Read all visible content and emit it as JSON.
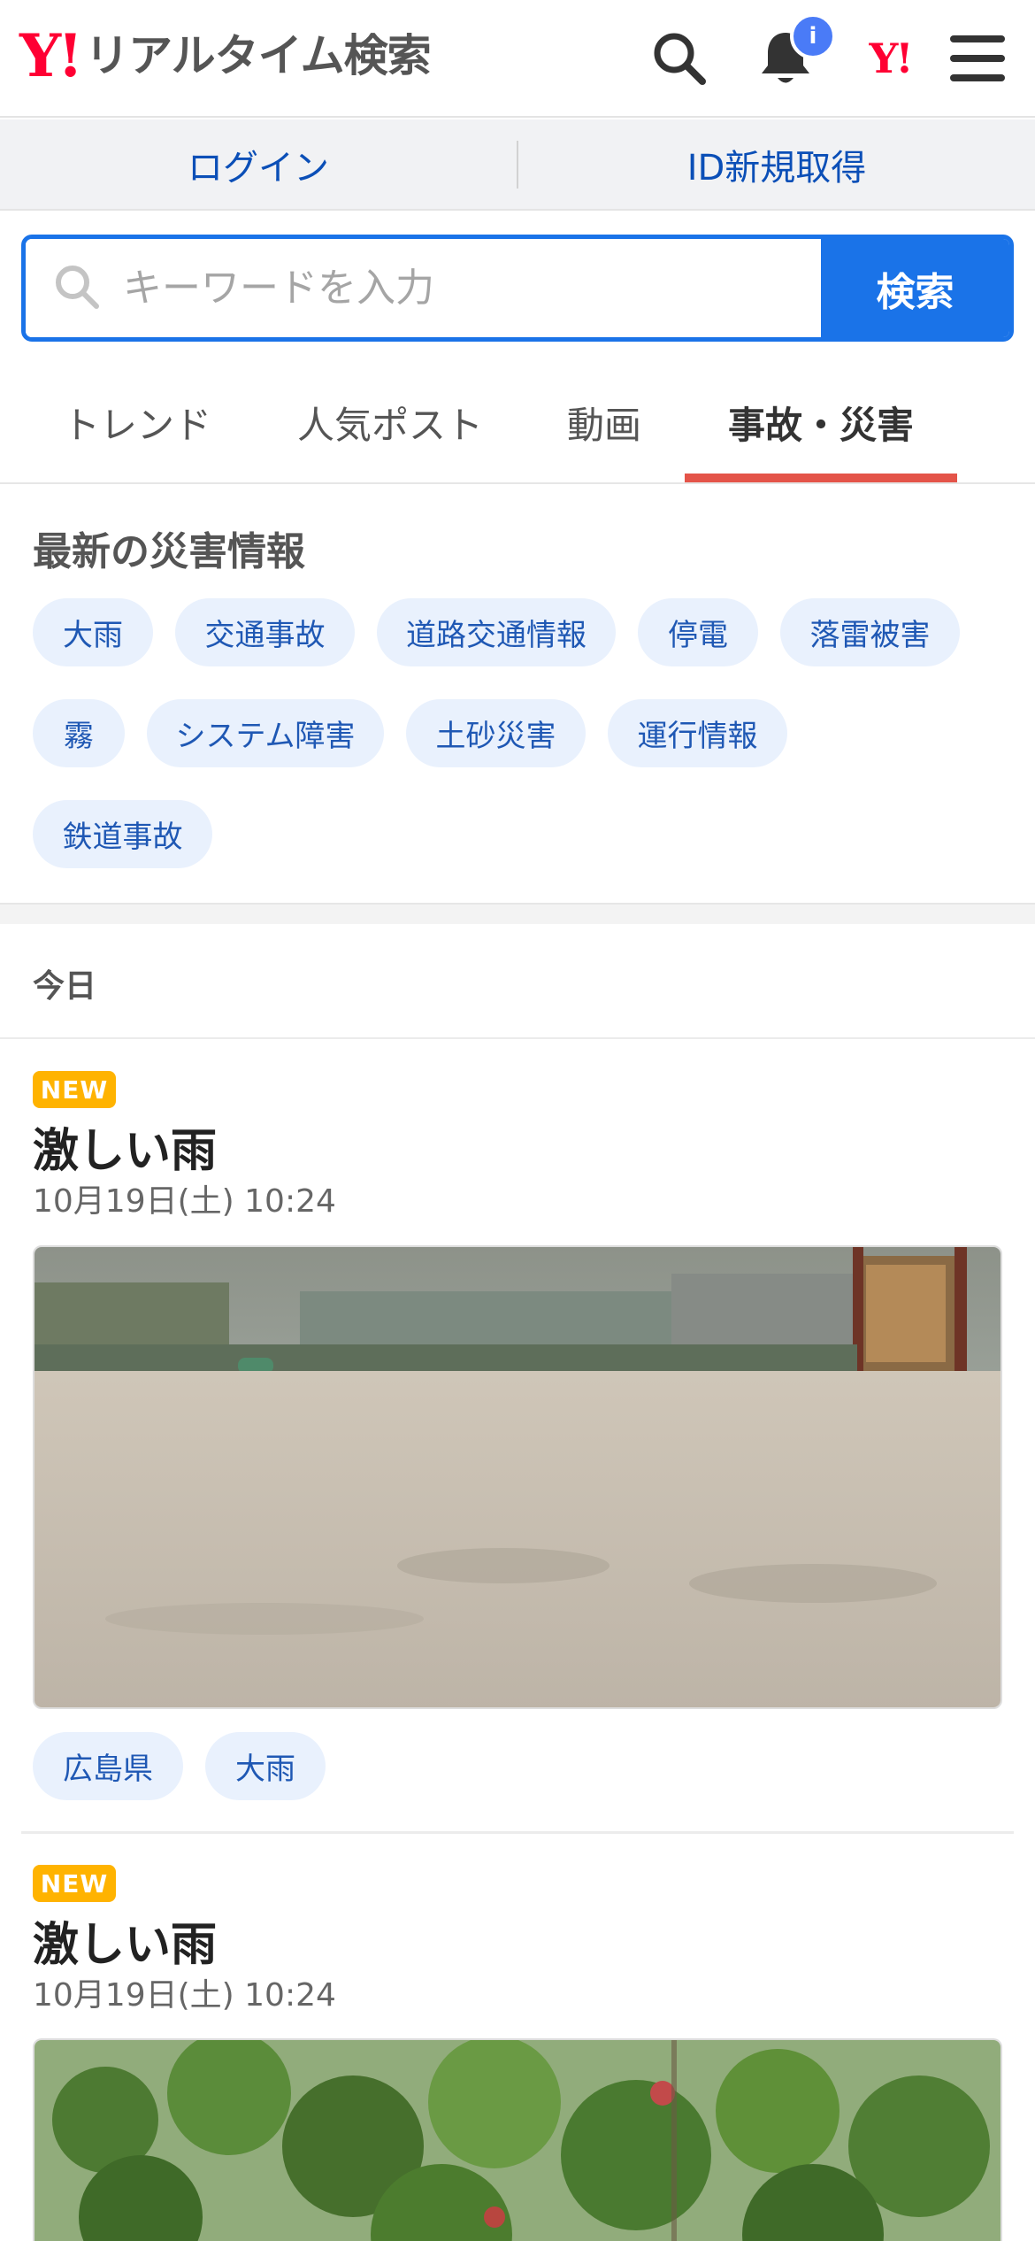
{
  "header": {
    "logo_mark": "Y!",
    "logo_text": "リアルタイム検索",
    "notification_badge": "i",
    "yj_mark": "Y!"
  },
  "loginbar": {
    "login_label": "ログイン",
    "register_label": "ID新規取得"
  },
  "search": {
    "placeholder": "キーワードを入力",
    "value": "",
    "button_label": "検索"
  },
  "tabs": [
    {
      "label": "トレンド",
      "active": false
    },
    {
      "label": "人気ポスト",
      "active": false
    },
    {
      "label": "動画",
      "active": false
    },
    {
      "label": "事故・災害",
      "active": true
    }
  ],
  "disaster": {
    "title": "最新の災害情報",
    "chips": [
      "大雨",
      "交通事故",
      "道路交通情報",
      "停電",
      "落雷被害",
      "霧",
      "システム障害",
      "土砂災害",
      "運行情報",
      "鉄道事故"
    ]
  },
  "date_group": "今日",
  "posts": [
    {
      "badge": "NEW",
      "title": "激しい雨",
      "date": "10月19日(土) 10:24",
      "image": "heavy-rain-field-photo",
      "tags": [
        "広島県",
        "大雨"
      ]
    },
    {
      "badge": "NEW",
      "title": "激しい雨",
      "date": "10月19日(土) 10:24",
      "image": "rain-tree-photo",
      "tags": []
    }
  ],
  "colors": {
    "brand_red": "#ff0033",
    "accent_blue": "#1a73e8",
    "link_blue": "#0b4fb7",
    "chip_bg": "#e9f1fd",
    "new_badge": "#ffb300",
    "tab_underline": "#e45449"
  }
}
